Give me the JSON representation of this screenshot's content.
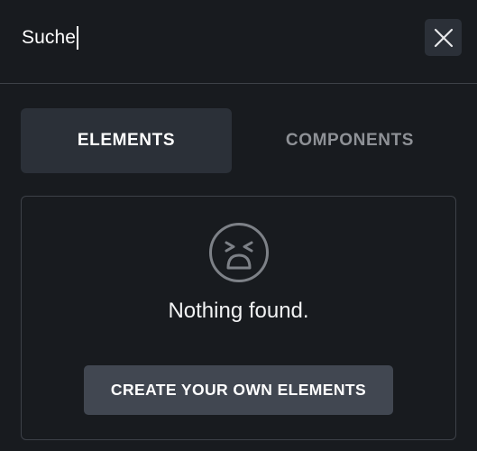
{
  "search": {
    "value": "Suche"
  },
  "tabs": [
    {
      "label": "ELEMENTS",
      "active": true
    },
    {
      "label": "COMPONENTS",
      "active": false
    }
  ],
  "results": {
    "empty_icon": "sad-face-icon",
    "empty_message": "Nothing found.",
    "create_button_label": "CREATE YOUR OWN ELEMENTS"
  },
  "icons": {
    "close": "close-icon"
  },
  "colors": {
    "background": "#181b1f",
    "active_tab": "#2b3038",
    "button": "#414751",
    "inactive_text": "#8e9196",
    "border": "#3d4148"
  }
}
